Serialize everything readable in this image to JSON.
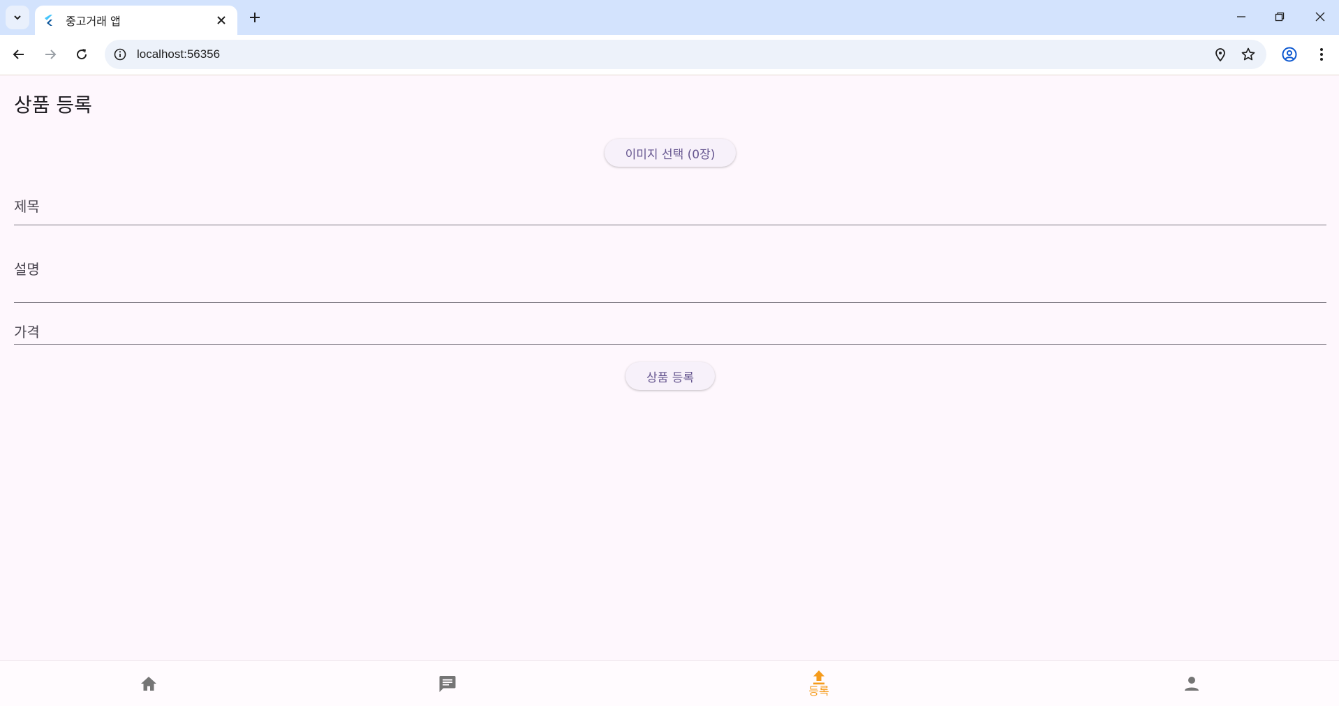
{
  "browser": {
    "tab_title": "중고거래 앱",
    "url": "localhost:56356"
  },
  "page": {
    "title": "상품 등록",
    "image_button_label": "이미지 선택 (0장)",
    "submit_button_label": "상품 등록"
  },
  "form": {
    "title_label": "제목",
    "description_label": "설명",
    "price_label": "가격"
  },
  "bottom_nav": {
    "items": [
      {
        "icon": "home-icon",
        "label": ""
      },
      {
        "icon": "chat-icon",
        "label": ""
      },
      {
        "icon": "upload-icon",
        "label": "등록"
      },
      {
        "icon": "person-icon",
        "label": ""
      }
    ],
    "active_color": "#f59b1c",
    "inactive_color": "#757575"
  },
  "colors": {
    "background": "#fef7fd",
    "accent_text": "#65558f",
    "tabstrip": "#d3e3fd"
  }
}
